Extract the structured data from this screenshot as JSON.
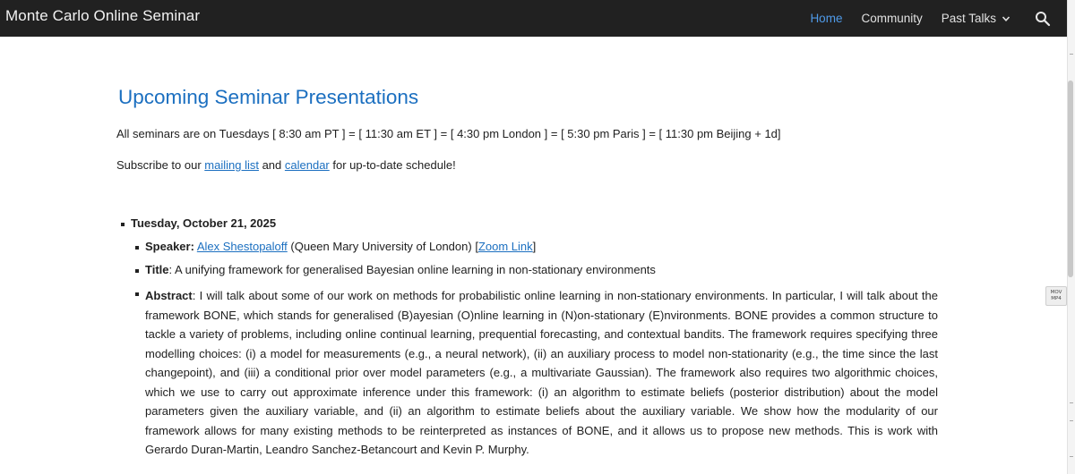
{
  "site": {
    "title": "Monte Carlo Online Seminar"
  },
  "nav": {
    "home": "Home",
    "community": "Community",
    "past_talks": "Past Talks"
  },
  "side_badge": {
    "line1": "MOV",
    "line2": "MP4"
  },
  "main": {
    "heading": "Upcoming Seminar Presentations",
    "schedule_line": "All seminars are on Tuesdays  [ 8:30 am PT ] = [ 11:30 am ET ] = [ 4:30 pm London ] = [ 5:30 pm Paris ] = [ 11:30 pm Beijing  + 1d]",
    "subscribe": {
      "prefix": "Subscribe to our ",
      "mailing_list": "mailing list",
      "and": " and ",
      "calendar": "calendar",
      "suffix": " for up-to-date schedule!"
    },
    "talk": {
      "date": "Tuesday, October 21, 2025",
      "speaker_label": "Speaker:",
      "speaker_name": "Alex Shestopaloff",
      "speaker_affil": " (Queen Mary University of London)   [",
      "zoom_link": "Zoom Link",
      "zoom_close": "]",
      "title_label": "Title",
      "title_text": ": A unifying framework for generalised Bayesian online learning in non-stationary environments",
      "abstract_label": "Abstract",
      "abstract_text": ": I will talk about some of our work on methods for probabilistic online learning in non-stationary environments. In particular, I will talk about the framework BONE, which stands for generalised (B)ayesian (O)nline learning in (N)on-stationary (E)nvironments.  BONE provides a common structure to tackle a variety of problems, including online continual learning, prequential forecasting,  and contextual bandits. The framework requires specifying three modelling choices: (i) a model for measurements (e.g., a neural network), (ii) an auxiliary process to model non-stationarity (e.g., the time since the last changepoint), and (iii) a conditional prior over model parameters  (e.g., a multivariate Gaussian). The framework also requires two algorithmic choices, which we use to carry out approximate inference under this framework: (i) an algorithm to estimate beliefs (posterior distribution) about the model parameters given the auxiliary variable, and (ii) an algorithm to estimate beliefs about the auxiliary variable. We show how the modularity of our framework allows for many existing methods to be reinterpreted as instances of BONE, and it allows us to propose new methods. This is work with Gerardo Duran-Martin, Leandro Sanchez-Betancourt and Kevin P. Murphy."
    }
  },
  "colors": {
    "topbar": "#212121",
    "accent_blue": "#1b6fc0",
    "nav_active": "#4f9ae8"
  }
}
